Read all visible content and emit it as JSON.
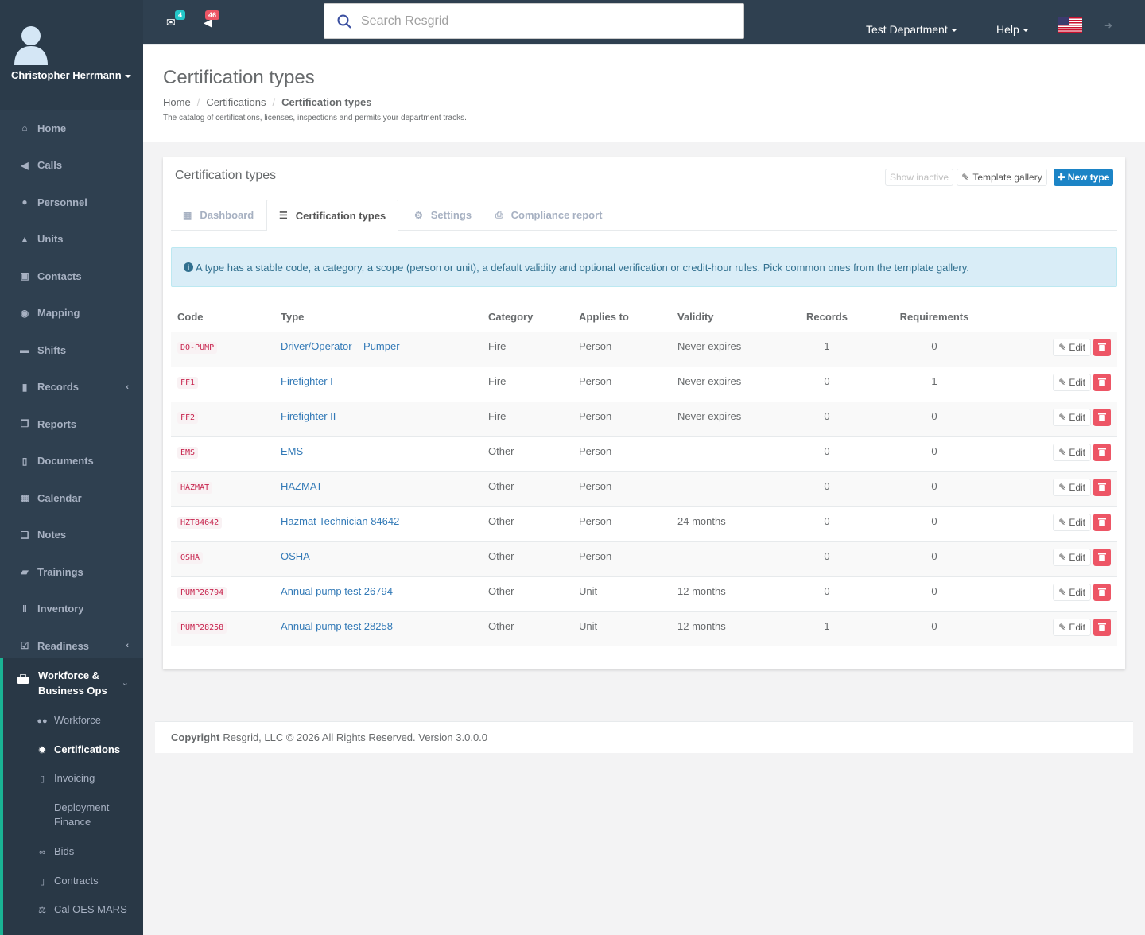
{
  "user": {
    "name": "Christopher Herrmann"
  },
  "nav": {
    "items": [
      {
        "label": "Home",
        "icon": "home-icon"
      },
      {
        "label": "Calls",
        "icon": "bullhorn-icon"
      },
      {
        "label": "Personnel",
        "icon": "user-icon"
      },
      {
        "label": "Units",
        "icon": "truck-icon"
      },
      {
        "label": "Contacts",
        "icon": "address-book-icon"
      },
      {
        "label": "Mapping",
        "icon": "map-marker-icon"
      },
      {
        "label": "Shifts",
        "icon": "briefcase-icon"
      },
      {
        "label": "Records",
        "icon": "file-icon"
      },
      {
        "label": "Reports",
        "icon": "reports-icon"
      },
      {
        "label": "Documents",
        "icon": "document-icon"
      },
      {
        "label": "Calendar",
        "icon": "calendar-icon"
      },
      {
        "label": "Notes",
        "icon": "notes-icon"
      },
      {
        "label": "Trainings",
        "icon": "book-icon"
      },
      {
        "label": "Inventory",
        "icon": "barcode-icon"
      },
      {
        "label": "Readiness",
        "icon": "check-square-icon"
      }
    ],
    "group": {
      "label": "Workforce & Business Ops",
      "subitems": [
        {
          "label": "Workforce"
        },
        {
          "label": "Certifications"
        },
        {
          "label": "Invoicing"
        },
        {
          "label": "Deployment Finance"
        },
        {
          "label": "Bids"
        },
        {
          "label": "Contracts"
        },
        {
          "label": "Cal OES MARS"
        }
      ]
    }
  },
  "topbar": {
    "mail_count": "4",
    "alert_count": "46",
    "search_placeholder": "Search Resgrid",
    "department": "Test Department",
    "help": "Help"
  },
  "page": {
    "title": "Certification types",
    "breadcrumb": [
      "Home",
      "Certifications",
      "Certification types"
    ],
    "description": "The catalog of certifications, licenses, inspections and permits your department tracks."
  },
  "card": {
    "title": "Certification types",
    "show_inactive": "Show inactive",
    "template_gallery": "Template gallery",
    "new_type": "New type",
    "tabs": [
      "Dashboard",
      "Certification types",
      "Settings",
      "Compliance report"
    ],
    "info": "A type has a stable code, a category, a scope (person or unit), a default validity and optional verification or credit-hour rules. Pick common ones from the template gallery."
  },
  "table": {
    "headers": [
      "Code",
      "Type",
      "Category",
      "Applies to",
      "Validity",
      "Records",
      "Requirements"
    ],
    "edit_label": "Edit",
    "rows": [
      {
        "code": "DO-PUMP",
        "type": "Driver/Operator – Pumper",
        "category": "Fire",
        "applies": "Person",
        "validity": "Never expires",
        "records": "1",
        "requirements": "0"
      },
      {
        "code": "FF1",
        "type": "Firefighter I",
        "category": "Fire",
        "applies": "Person",
        "validity": "Never expires",
        "records": "0",
        "requirements": "1"
      },
      {
        "code": "FF2",
        "type": "Firefighter II",
        "category": "Fire",
        "applies": "Person",
        "validity": "Never expires",
        "records": "0",
        "requirements": "0"
      },
      {
        "code": "EMS",
        "type": "EMS",
        "category": "Other",
        "applies": "Person",
        "validity": "—",
        "records": "0",
        "requirements": "0"
      },
      {
        "code": "HAZMAT",
        "type": "HAZMAT",
        "category": "Other",
        "applies": "Person",
        "validity": "—",
        "records": "0",
        "requirements": "0"
      },
      {
        "code": "HZT84642",
        "type": "Hazmat Technician 84642",
        "category": "Other",
        "applies": "Person",
        "validity": "24 months",
        "records": "0",
        "requirements": "0"
      },
      {
        "code": "OSHA",
        "type": "OSHA",
        "category": "Other",
        "applies": "Person",
        "validity": "—",
        "records": "0",
        "requirements": "0"
      },
      {
        "code": "PUMP26794",
        "type": "Annual pump test 26794",
        "category": "Other",
        "applies": "Unit",
        "validity": "12 months",
        "records": "0",
        "requirements": "0"
      },
      {
        "code": "PUMP28258",
        "type": "Annual pump test 28258",
        "category": "Other",
        "applies": "Unit",
        "validity": "12 months",
        "records": "1",
        "requirements": "0"
      }
    ]
  },
  "footer": {
    "copyright": "Copyright",
    "text": "Resgrid, LLC © 2026 All Rights Reserved.",
    "version": "Version 3.0.0.0"
  }
}
